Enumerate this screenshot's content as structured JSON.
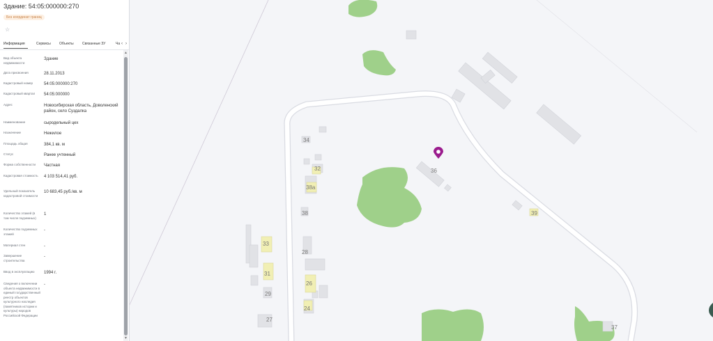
{
  "panel": {
    "title": "Здание: 54:05:000000:270",
    "badge": "Без координат границ",
    "tabs": [
      "Информация",
      "Сервисы",
      "Объекты",
      "Связанные ЗУ",
      "Ча"
    ],
    "rows": [
      {
        "label": "Вид объекта недвижимости",
        "value": "Здание"
      },
      {
        "label": "Дата присвоения",
        "value": "28.11.2013"
      },
      {
        "label": "Кадастровый номер",
        "value": "54:05:000000:270"
      },
      {
        "label": "Кадастровый квартал",
        "value": "54:05:000000"
      },
      {
        "label": "Адрес",
        "value": "Новосибирская область, Доволенский район, село Суздалка"
      },
      {
        "label": "Наименование",
        "value": "сыродельный цех"
      },
      {
        "label": "Назначение",
        "value": "Нежилое"
      },
      {
        "label": "Площадь общая",
        "value": "384,1 кв. м"
      },
      {
        "label": "Статус",
        "value": "Ранее учтенный"
      },
      {
        "label": "Форма собственности",
        "value": "Частная"
      },
      {
        "label": "Кадастровая стоимость",
        "value": "4 103 514,41 руб."
      },
      {
        "label": "Удельный показатель кадастровой стоимости",
        "value": "10 683,45 руб./кв. м"
      },
      {
        "label": "Количество этажей (в том числе подземных)",
        "value": "1"
      },
      {
        "label": "Количество подземных этажей",
        "value": "-"
      },
      {
        "label": "Материал стен",
        "value": "-"
      },
      {
        "label": "Завершение строительства",
        "value": "-"
      },
      {
        "label": "Ввод в эксплуатацию",
        "value": "1994 г."
      },
      {
        "label": "Сведения о включении объекта недвижимости в единый государственный реестр объектов культурного наследия (памятников истории и культуры) народов Российской Федерации",
        "value": "-"
      }
    ]
  },
  "map": {
    "house_numbers": [
      {
        "id": "34",
        "label": "34"
      },
      {
        "id": "32",
        "label": "32"
      },
      {
        "id": "38a",
        "label": "38а"
      },
      {
        "id": "38",
        "label": "38"
      },
      {
        "id": "36",
        "label": "36"
      },
      {
        "id": "39",
        "label": "39"
      },
      {
        "id": "33",
        "label": "33"
      },
      {
        "id": "28",
        "label": "28"
      },
      {
        "id": "31",
        "label": "31"
      },
      {
        "id": "26",
        "label": "26"
      },
      {
        "id": "29",
        "label": "29"
      },
      {
        "id": "24",
        "label": "24"
      },
      {
        "id": "27",
        "label": "27"
      },
      {
        "id": "37",
        "label": "37"
      }
    ],
    "colors": {
      "background": "#f4f5f8",
      "vegetation": "#9fd08a",
      "building": "#e1e2e6",
      "building_highlight": "#f1efb4",
      "road": "#ffffff",
      "road_edge": "#d9dbe2",
      "pin": "#9b1c8e"
    }
  }
}
